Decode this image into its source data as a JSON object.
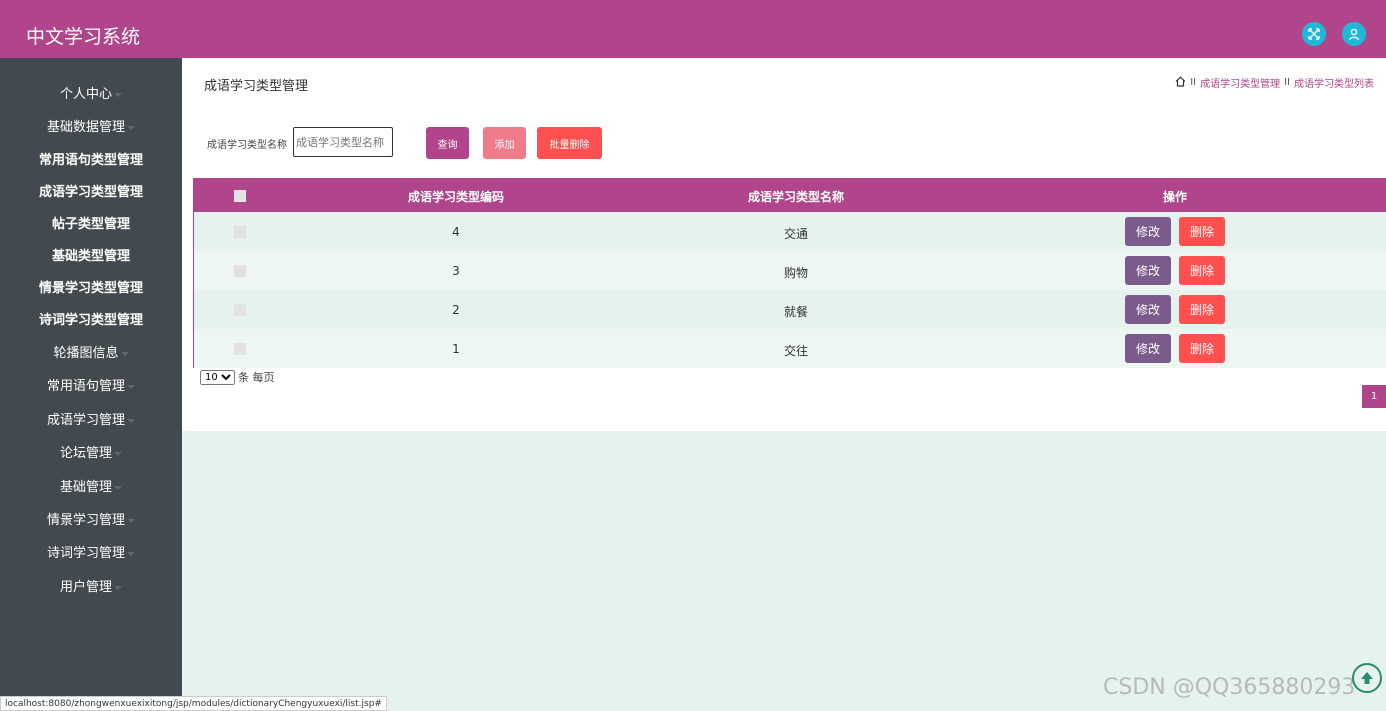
{
  "app": {
    "title": "中文学习系统"
  },
  "header_icons": [
    "fullscreen-icon",
    "user-icon"
  ],
  "sidebar": {
    "items": [
      {
        "label": "个人中心",
        "dropdown": true
      },
      {
        "label": "基础数据管理",
        "dropdown": true
      },
      {
        "label": "常用语句类型管理",
        "dropdown": false
      },
      {
        "label": "成语学习类型管理",
        "dropdown": false
      },
      {
        "label": "帖子类型管理",
        "dropdown": false
      },
      {
        "label": "基础类型管理",
        "dropdown": false
      },
      {
        "label": "情景学习类型管理",
        "dropdown": false
      },
      {
        "label": "诗词学习类型管理",
        "dropdown": false
      },
      {
        "label": "轮播图信息",
        "dropdown": true
      },
      {
        "label": "常用语句管理",
        "dropdown": true
      },
      {
        "label": "成语学习管理",
        "dropdown": true
      },
      {
        "label": "论坛管理",
        "dropdown": true
      },
      {
        "label": "基础管理",
        "dropdown": true
      },
      {
        "label": "情景学习管理",
        "dropdown": true
      },
      {
        "label": "诗词学习管理",
        "dropdown": true
      },
      {
        "label": "用户管理",
        "dropdown": true
      }
    ]
  },
  "page": {
    "title": "成语学习类型管理",
    "breadcrumb": [
      "成语学习类型管理",
      "成语学习类型列表"
    ],
    "breadcrumb_sep": "II"
  },
  "search": {
    "label": "成语学习类型名称",
    "placeholder": "成语学习类型名称",
    "value": "",
    "query_label": "查询",
    "add_label": "添加",
    "batch_delete_label": "批量删除"
  },
  "table": {
    "headers": [
      "成语学习类型编码",
      "成语学习类型名称",
      "操作"
    ],
    "rows": [
      {
        "code": "4",
        "name": "交通"
      },
      {
        "code": "3",
        "name": "购物"
      },
      {
        "code": "2",
        "name": "就餐"
      },
      {
        "code": "1",
        "name": "交往"
      }
    ],
    "edit_label": "修改",
    "delete_label": "删除"
  },
  "pagination": {
    "per_page_value": "10",
    "per_page_options": [
      "10"
    ],
    "per_page_suffix": "条 每页",
    "current_page": "1"
  },
  "status_url": "localhost:8080/zhongwenxuexixitong/jsp/modules/dictionaryChengyuxuexi/list.jsp#",
  "watermark": "CSDN @QQ3658802­93",
  "colors": {
    "brand": "#b0458c",
    "sidebar_bg": "#424a50",
    "edit_button": "#7a5b8c",
    "delete_button": "#ff4f4f",
    "add_button": "#f27b8a",
    "content_bg": "#e6f2ed",
    "header_icon_bg": "#1fb8d6"
  }
}
